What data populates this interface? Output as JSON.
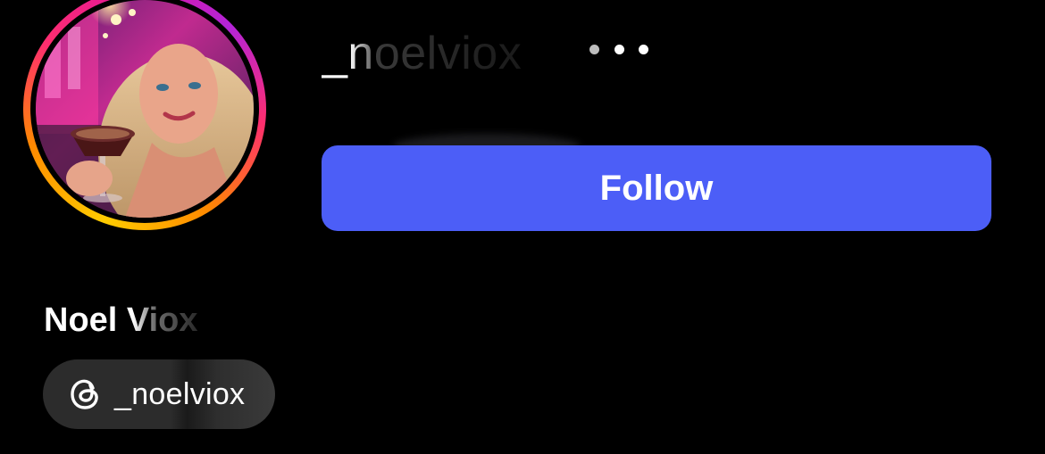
{
  "profile": {
    "username": "_noelviox",
    "display_name": "Noel Viox",
    "avatar_alt": "profile photo"
  },
  "header": {
    "more_icon": "more-horizontal-icon"
  },
  "actions": {
    "follow_label": "Follow"
  },
  "threads_badge": {
    "icon": "threads-icon",
    "handle": "_noelviox"
  },
  "colors": {
    "background": "#000000",
    "follow_button": "#4c5ef7",
    "pill_background": "#2c2c2c",
    "ring_gradient": [
      "#ffcc00",
      "#ff8a00",
      "#ff2e6e",
      "#e1169c",
      "#b424d9"
    ]
  }
}
